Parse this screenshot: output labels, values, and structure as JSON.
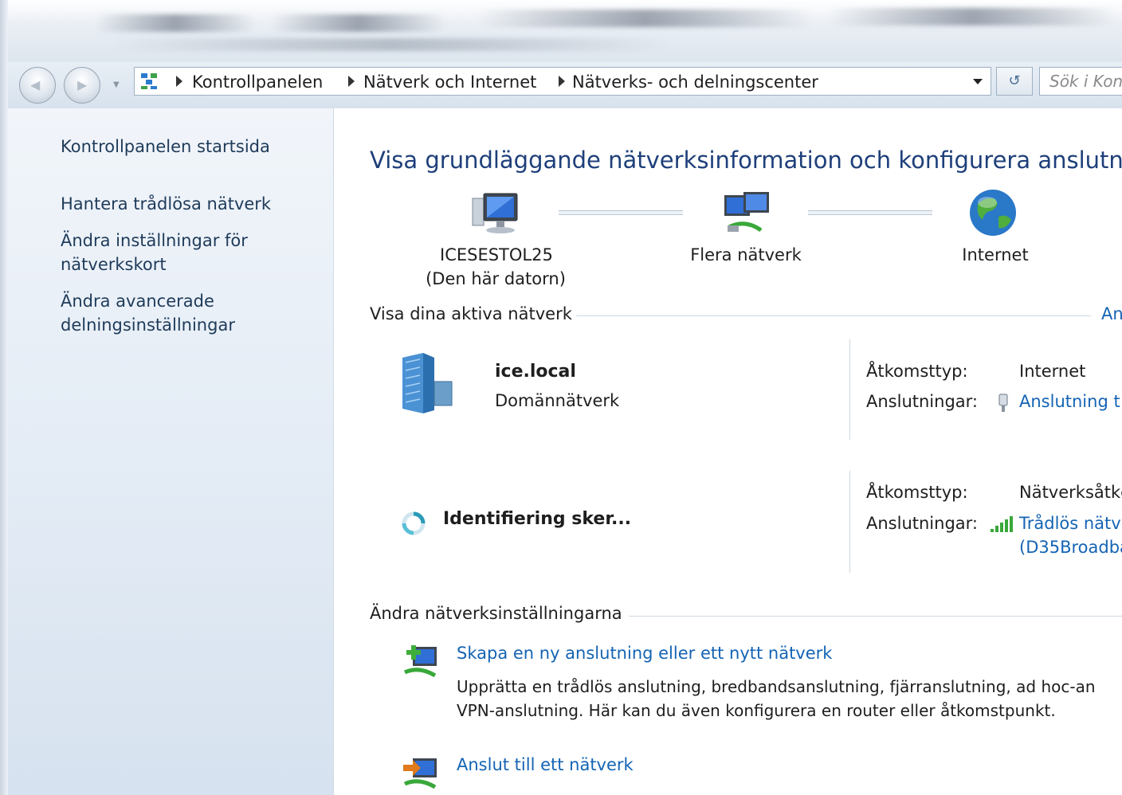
{
  "address_bar": {
    "breadcrumbs": [
      "Kontrollpanelen",
      "Nätverk och Internet",
      "Nätverks- och delningscenter"
    ],
    "search_placeholder": "Sök i Kon"
  },
  "sidebar": {
    "items": [
      {
        "label": "Kontrollpanelen startsida"
      },
      {
        "label": "Hantera trådlösa nätverk"
      },
      {
        "label_line1": "Ändra inställningar för",
        "label_line2": "nätverkskort"
      },
      {
        "label_line1": "Ändra avancerade",
        "label_line2": "delningsinställningar"
      }
    ]
  },
  "main": {
    "title": "Visa grundläggande nätverksinformation och konfigurera anslutning",
    "network_map": {
      "computer": {
        "name": "ICESESTOL25",
        "subtitle": "(Den här datorn)"
      },
      "middle": {
        "name": "Flera nätverk"
      },
      "internet": {
        "name": "Internet"
      }
    },
    "active_networks": {
      "header": "Visa dina aktiva nätverk",
      "right_link": "An",
      "networks": [
        {
          "name": "ice.local",
          "type": "Domännätverk",
          "access_type_label": "Åtkomsttyp:",
          "access_type_value": "Internet",
          "connections_label": "Anslutningar:",
          "connection_link": "Anslutning t"
        },
        {
          "name": "Identifiering sker...",
          "access_type_label": "Åtkomsttyp:",
          "access_type_value": "Nätverksåtkc",
          "connections_label": "Anslutningar:",
          "connection_link_line1": "Trådlös nätv",
          "connection_link_line2": "(D35Broadba"
        }
      ]
    },
    "change_settings": {
      "header": "Ändra nätverksinställningarna",
      "tasks": [
        {
          "link": "Skapa en ny anslutning eller ett nytt nätverk",
          "desc_line1": "Upprätta en trådlös anslutning, bredbandsanslutning, fjärranslutning, ad hoc-an",
          "desc_line2": "VPN-anslutning. Här kan du även konfigurera en router eller åtkomstpunkt."
        },
        {
          "link": "Anslut till ett nätverk"
        }
      ]
    }
  },
  "colors": {
    "link": "#1464b4",
    "title": "#1e3f7a",
    "pane_bg": "#e3ebf5"
  }
}
